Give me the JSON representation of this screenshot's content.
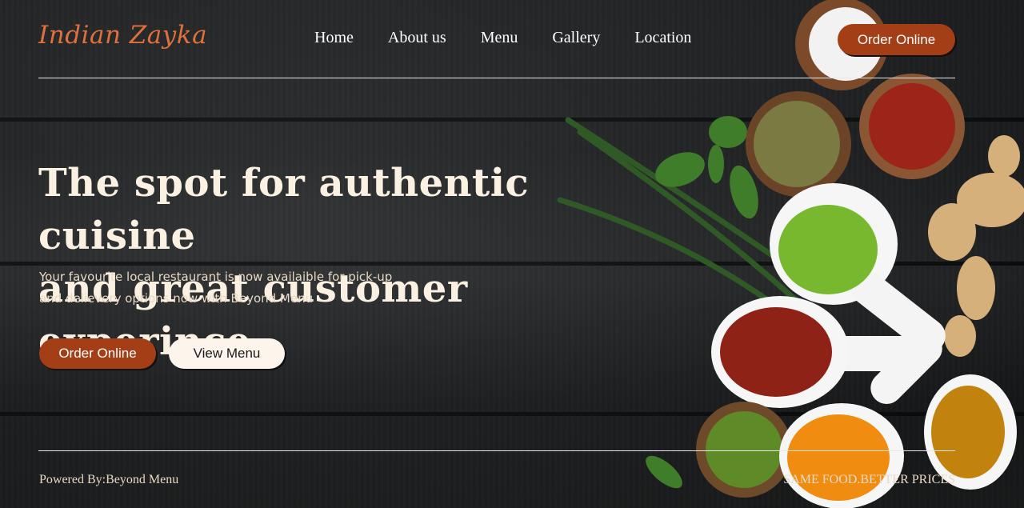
{
  "brand": {
    "logo_text": "Indian Zayka",
    "accent": "#e0703c",
    "button_color": "#a43e16"
  },
  "nav": {
    "items": [
      {
        "label": "Home"
      },
      {
        "label": "About us"
      },
      {
        "label": "Menu"
      },
      {
        "label": "Gallery"
      },
      {
        "label": "Location"
      }
    ],
    "order_label": "Order Online"
  },
  "hero": {
    "headline_line1": "The spot for authentic cuisine",
    "headline_line2": "and great customer experince",
    "tagline_line1": "Your favourite local restaurant is now availaible for pick-up",
    "tagline_line2": "and delievery options now with Beyond Menu",
    "order_label": "Order Online",
    "view_menu_label": "View Menu"
  },
  "footer": {
    "powered_by": "Powered By:Beyond Menu",
    "slogan": "SAME FOOD.BETTER PRICES"
  },
  "icons": [
    "spice-bowls-image"
  ]
}
